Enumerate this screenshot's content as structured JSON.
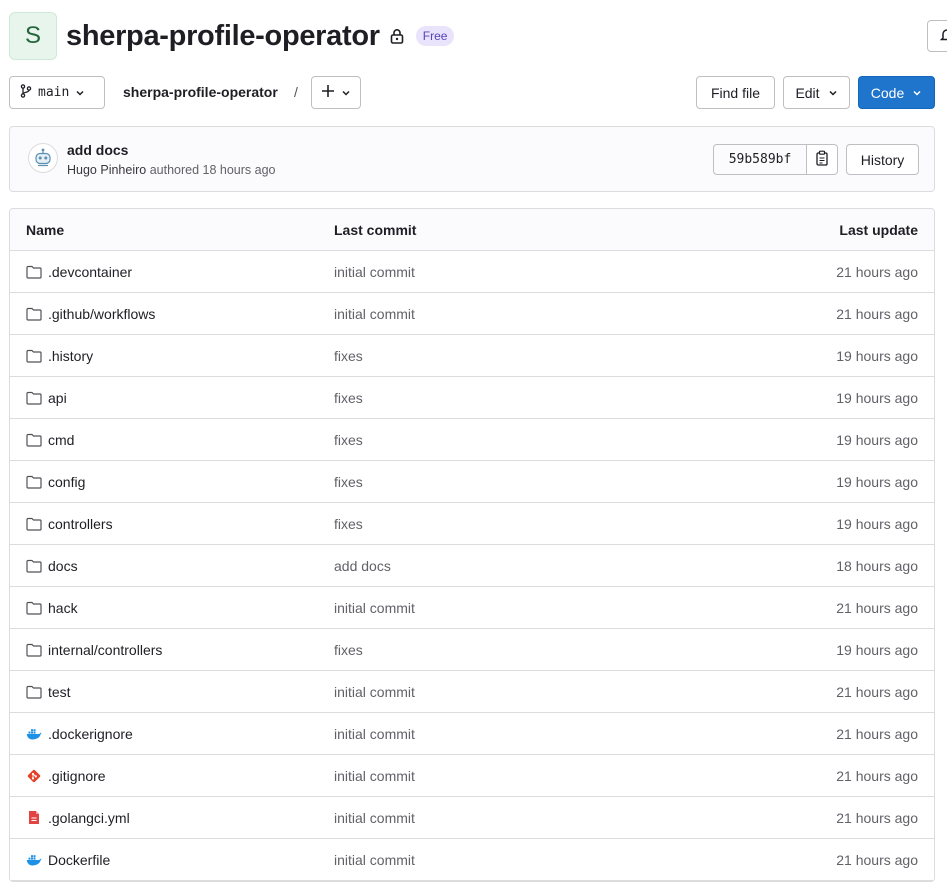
{
  "header": {
    "avatar_letter": "S",
    "project_name": "sherpa-profile-operator",
    "visibility_badge": "Free"
  },
  "toolbar": {
    "branch": "main",
    "breadcrumb": "sherpa-profile-operator",
    "separator": "/",
    "find_file": "Find file",
    "edit": "Edit",
    "code": "Code"
  },
  "commit": {
    "title": "add docs",
    "author": "Hugo Pinheiro",
    "authored_text": "authored 18 hours ago",
    "sha": "59b589bf",
    "history": "History"
  },
  "table": {
    "headers": {
      "name": "Name",
      "last_commit": "Last commit",
      "last_update": "Last update"
    },
    "rows": [
      {
        "name": ".devcontainer",
        "icon": "folder-icon",
        "commit": "initial commit",
        "updated": "21 hours ago"
      },
      {
        "name": ".github/workflows",
        "icon": "folder-icon",
        "commit": "initial commit",
        "updated": "21 hours ago"
      },
      {
        "name": ".history",
        "icon": "folder-icon",
        "commit": "fixes",
        "updated": "19 hours ago"
      },
      {
        "name": "api",
        "icon": "folder-icon",
        "commit": "fixes",
        "updated": "19 hours ago"
      },
      {
        "name": "cmd",
        "icon": "folder-icon",
        "commit": "fixes",
        "updated": "19 hours ago"
      },
      {
        "name": "config",
        "icon": "folder-icon",
        "commit": "fixes",
        "updated": "19 hours ago"
      },
      {
        "name": "controllers",
        "icon": "folder-icon",
        "commit": "fixes",
        "updated": "19 hours ago"
      },
      {
        "name": "docs",
        "icon": "folder-icon",
        "commit": "add docs",
        "updated": "18 hours ago"
      },
      {
        "name": "hack",
        "icon": "folder-icon",
        "commit": "initial commit",
        "updated": "21 hours ago"
      },
      {
        "name": "internal/controllers",
        "icon": "folder-icon",
        "commit": "fixes",
        "updated": "19 hours ago"
      },
      {
        "name": "test",
        "icon": "folder-icon",
        "commit": "initial commit",
        "updated": "21 hours ago"
      },
      {
        "name": ".dockerignore",
        "icon": "docker-icon",
        "commit": "initial commit",
        "updated": "21 hours ago"
      },
      {
        "name": ".gitignore",
        "icon": "git-icon",
        "commit": "initial commit",
        "updated": "21 hours ago"
      },
      {
        "name": ".golangci.yml",
        "icon": "yaml-file-icon",
        "commit": "initial commit",
        "updated": "21 hours ago"
      },
      {
        "name": "Dockerfile",
        "icon": "docker-icon",
        "commit": "initial commit",
        "updated": "21 hours ago"
      }
    ]
  },
  "colors": {
    "primary": "#1f75cb",
    "badge_bg": "#e9e3fb",
    "badge_text": "#5943b6",
    "docker": "#1d91e6",
    "git": "#e24329",
    "yaml": "#e24343"
  }
}
